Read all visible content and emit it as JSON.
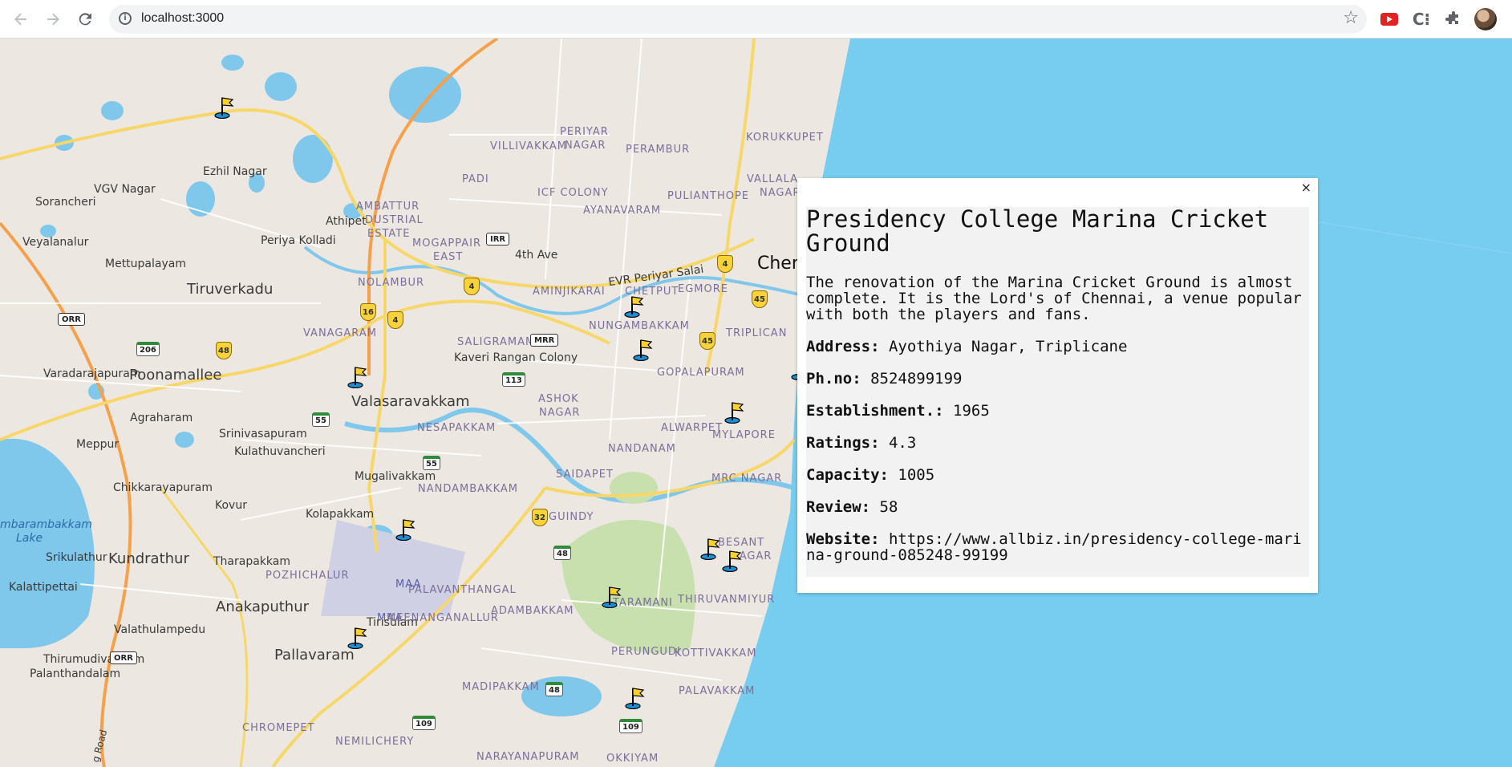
{
  "browser": {
    "url": "localhost:3000",
    "back_icon": "back-arrow-icon",
    "forward_icon": "forward-arrow-icon",
    "reload_icon": "reload-icon",
    "star_icon": "bookmark-star-icon"
  },
  "map": {
    "area_labels": [
      {
        "text": "Ezhil Nagar"
      },
      {
        "text": "VGV Nagar"
      },
      {
        "text": "Sorancheri"
      },
      {
        "text": "Veyalanalur"
      },
      {
        "text": "Mettupalayam"
      },
      {
        "text": "Tiruverkadu"
      },
      {
        "text": "Periya Kolladi"
      },
      {
        "text": "Athipet"
      },
      {
        "text": "AMBATTUR"
      },
      {
        "text": "DUSTRIAL"
      },
      {
        "text": "ESTATE"
      },
      {
        "text": "MOGAPPAIR"
      },
      {
        "text": "EAST"
      },
      {
        "text": "NOLAMBUR"
      },
      {
        "text": "VANAGARAM"
      },
      {
        "text": "Varadarajapuram"
      },
      {
        "text": "Poonamallee"
      },
      {
        "text": "Valasaravakkam"
      },
      {
        "text": "Agraharam"
      },
      {
        "text": "Srinivasapuram"
      },
      {
        "text": "Kulathuvancheri"
      },
      {
        "text": "Meppur"
      },
      {
        "text": "Mugalivakkam"
      },
      {
        "text": "Chikkarayapuram"
      },
      {
        "text": "Kovur"
      },
      {
        "text": "Kolapakkam"
      },
      {
        "text": "Kundrathur"
      },
      {
        "text": "Srikulathur"
      },
      {
        "text": "Tharapakkam"
      },
      {
        "text": "POZHICHALUR"
      },
      {
        "text": "Kalattipettai"
      },
      {
        "text": "Anakaputhur"
      },
      {
        "text": "Valathulampedu"
      },
      {
        "text": "Tirisulam"
      },
      {
        "text": "Thirumudivakkam"
      },
      {
        "text": "Palanthandalam"
      },
      {
        "text": "Pallavaram"
      },
      {
        "text": "CHROMEPET"
      },
      {
        "text": "NEMILICHERY"
      },
      {
        "text": "VILLIVAKKAM"
      },
      {
        "text": "PERIYAR"
      },
      {
        "text": "NAGAR"
      },
      {
        "text": "PERAMBUR"
      },
      {
        "text": "PADI"
      },
      {
        "text": "ICF COLONY"
      },
      {
        "text": "AYANAVARAM"
      },
      {
        "text": "PULIANTHOPE"
      },
      {
        "text": "4th Ave"
      },
      {
        "text": "AMINJIKARAI"
      },
      {
        "text": "CHETPUT"
      },
      {
        "text": "EGMORE"
      },
      {
        "text": "EVR Periyar Salai"
      },
      {
        "text": "NUNGAMBAKKAM"
      },
      {
        "text": "SALIGRAMAM"
      },
      {
        "text": "Kaveri Rangan Colony"
      },
      {
        "text": "GOPALAPURAM"
      },
      {
        "text": "ASHOK"
      },
      {
        "text": "NAGAR"
      },
      {
        "text": "NESAPAKKAM"
      },
      {
        "text": "ALWARPET"
      },
      {
        "text": "MYLAPORE"
      },
      {
        "text": "NANDANAM"
      },
      {
        "text": "SAIDAPET"
      },
      {
        "text": "MRC NAGAR"
      },
      {
        "text": "NANDAMBAKKAM"
      },
      {
        "text": "GUINDY"
      },
      {
        "text": "PALAVANTHANGAL"
      },
      {
        "text": "MAA"
      },
      {
        "text": "MAA"
      },
      {
        "text": "MEENANGANALLUR"
      },
      {
        "text": "ADAMBAKKAM"
      },
      {
        "text": "TARAMANI"
      },
      {
        "text": "THIRUVANMIYUR"
      },
      {
        "text": "PERUNGUDI"
      },
      {
        "text": "KOTTIVAKKAM"
      },
      {
        "text": "MADIPAKKAM"
      },
      {
        "text": "PALAVAKKAM"
      },
      {
        "text": "NARAYANAPURAM"
      },
      {
        "text": "OKKIYAM"
      },
      {
        "text": "VALLALA"
      },
      {
        "text": "NAGAR"
      },
      {
        "text": "TRIPLICAN"
      },
      {
        "text": "Chen"
      },
      {
        "text": "BESANT"
      },
      {
        "text": "NAGAR"
      },
      {
        "text": "KORUKKUPET"
      },
      {
        "text": "mbarambakkam"
      },
      {
        "text": "Lake"
      },
      {
        "text": "g Road"
      }
    ],
    "route_shields": {
      "state": [
        "4",
        "4",
        "16",
        "4",
        "4",
        "48",
        "45",
        "45",
        "32"
      ],
      "national": [
        "206",
        "113",
        "55",
        "55",
        "48",
        "48",
        "109",
        "109"
      ],
      "ring": [
        "IRR",
        "MRR",
        "ORR",
        "ORR"
      ]
    },
    "marker_icon": "cricket-ground-flag-icon"
  },
  "popup": {
    "close_label": "×",
    "title": "Presidency College Marina Cricket Ground",
    "description": "The renovation of the Marina Cricket Ground is almost complete. It is the Lord's of Chennai, a venue popular with both the players and fans.",
    "fields": [
      {
        "label": "Address:",
        "value": "Ayothiya Nagar, Triplicane"
      },
      {
        "label": "Ph.no:",
        "value": "8524899199"
      },
      {
        "label": "Establishment.:",
        "value": "1965"
      },
      {
        "label": "Ratings:",
        "value": "4.3"
      },
      {
        "label": "Capacity:",
        "value": "1005"
      },
      {
        "label": "Review:",
        "value": "58"
      },
      {
        "label": "Website:",
        "value": "https://www.allbiz.in/presidency-college-marina-ground-085248-99199"
      }
    ]
  },
  "colors": {
    "sea": "#76cdf0",
    "land": "#ece8e1",
    "highway": "#f5a04a",
    "road": "#f7d76a",
    "water_lake": "#7fc8ec",
    "park": "#c8dfae"
  }
}
